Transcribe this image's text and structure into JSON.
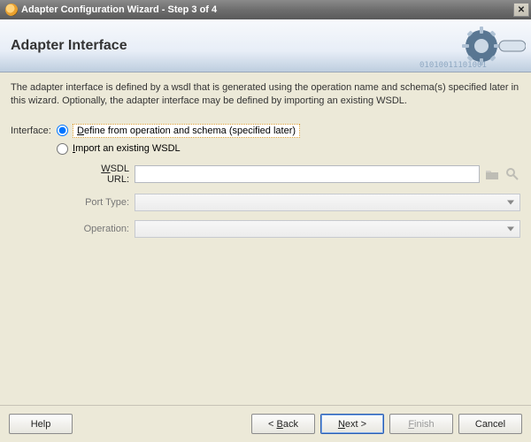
{
  "window": {
    "title": "Adapter Configuration Wizard - Step 3 of 4"
  },
  "banner": {
    "title": "Adapter Interface"
  },
  "description": "The adapter interface is defined by a wsdl that is generated using the operation name and schema(s) specified later in this wizard.  Optionally, the adapter interface may be defined by importing an existing WSDL.",
  "form": {
    "interface_label": "Interface:",
    "radio_define": "Define from operation and schema (specified later)",
    "radio_import": "Import an existing WSDL",
    "wsdl_label_prefix": "W",
    "wsdl_label_rest": "SDL URL:",
    "wsdl_value": "",
    "port_label": "Port Type:",
    "port_value": "",
    "operation_label": "Operation:",
    "operation_value": "",
    "selected": "define"
  },
  "buttons": {
    "help": "Help",
    "back": "< Back",
    "next": "Next >",
    "finish": "Finish",
    "cancel": "Cancel"
  }
}
